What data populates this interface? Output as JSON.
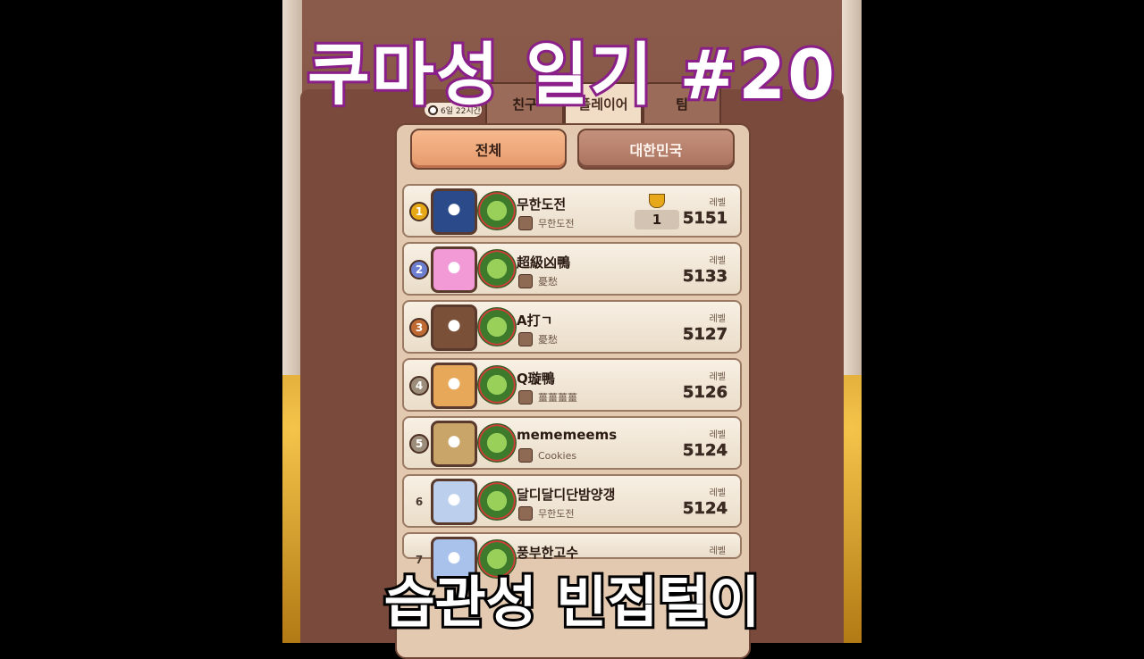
{
  "overlay": {
    "top_title": "쿠마성 일기 #20",
    "bottom_caption": "습관성 빈집털이"
  },
  "tabs": [
    {
      "label": "친구",
      "active": false
    },
    {
      "label": "플레이어",
      "active": true
    },
    {
      "label": "팀",
      "active": false
    }
  ],
  "time_badge": "6일 22시간",
  "filters": {
    "all": "전체",
    "korea": "대한민국"
  },
  "level_label": "레벨",
  "rows": [
    {
      "rank": "1",
      "name": "무한도전",
      "guild": "무한도전",
      "level": "5151",
      "trophy": "1",
      "avatar_color": "#2b4a8a"
    },
    {
      "rank": "2",
      "name": "超級凶鴨",
      "guild": "憂愁",
      "level": "5133",
      "avatar_color": "#f19ad6"
    },
    {
      "rank": "3",
      "name": "A打ㄱ",
      "guild": "憂愁",
      "level": "5127",
      "avatar_color": "#7b5038"
    },
    {
      "rank": "4",
      "name": "Q璇鴨",
      "guild": "薑薑薑薑",
      "level": "5126",
      "avatar_color": "#e8a85a"
    },
    {
      "rank": "5",
      "name": "mememeems",
      "guild": "Cookies",
      "level": "5124",
      "avatar_color": "#c9a56a"
    },
    {
      "rank": "6",
      "name": "달디달디단밤양갱",
      "guild": "무한도전",
      "level": "5124",
      "avatar_color": "#bcd0ee"
    },
    {
      "rank": "7",
      "name": "풍부한고수",
      "guild": "",
      "level": "",
      "avatar_color": "#a8c2ec"
    }
  ],
  "colors": {
    "title_outline": "#8a1f8a",
    "rank1": "#e6a817",
    "rank2": "#6d7fd1",
    "rank3": "#c06a33"
  }
}
